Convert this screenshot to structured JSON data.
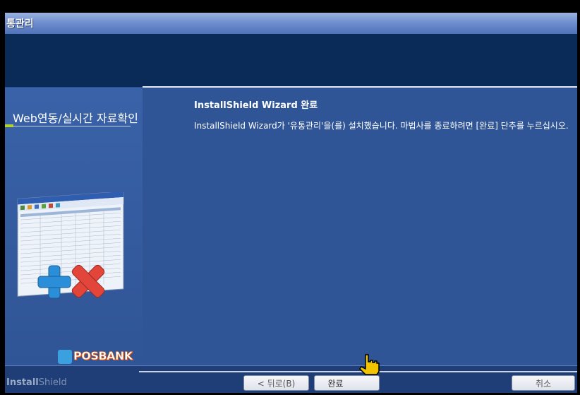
{
  "window": {
    "title": "통관리"
  },
  "sidebar": {
    "heading": "Web연동/실시간 자료확인",
    "brand": "POSBANK"
  },
  "main": {
    "title": "InstallShield Wizard 완료",
    "message": "InstallShield Wizard가 '유통관리'을(를) 설치했습니다. 마법사를 종료하려면 [완료] 단추를 누르십시오."
  },
  "footer": {
    "brand_part1": "Install",
    "brand_part2": "Shield",
    "back_label": "< 뒤로(B)",
    "finish_label": "완료",
    "cancel_label": "취소"
  },
  "colors": {
    "panel": "#2f5596",
    "header": "#0a2a57",
    "accent": "#b4d22c"
  }
}
